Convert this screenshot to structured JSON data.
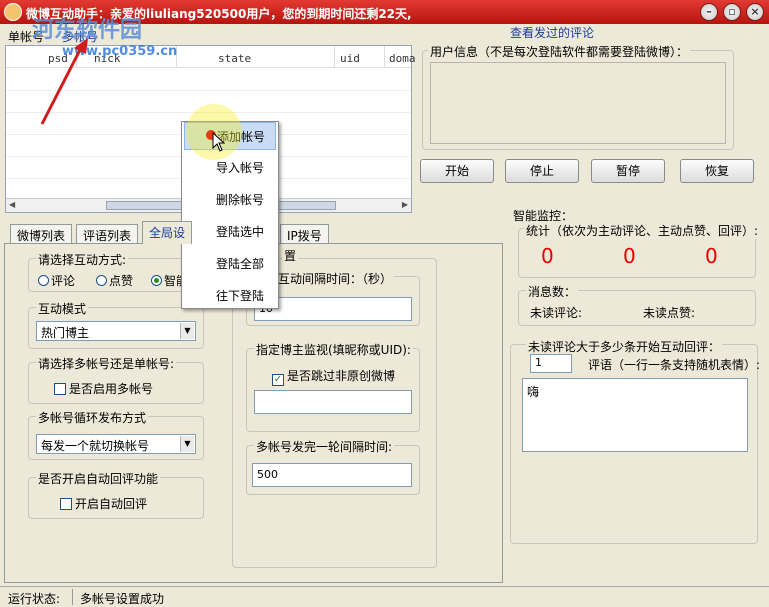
{
  "titlebar": {
    "title": "微博互动助手：亲爱的liuliang520500用户，您的到期时间还剩22天,",
    "min": "–",
    "restore": "▫",
    "close": "×"
  },
  "watermark": {
    "name": "河东软件园",
    "url": "www.pc0359.cn"
  },
  "top_tabs": [
    "单帐号",
    "多帐号"
  ],
  "grid": {
    "columns": [
      "psd",
      "nick",
      "state",
      "uid",
      "doma"
    ]
  },
  "right": {
    "view_comments": "查看发过的评论",
    "user_info_title": "用户信息（不是每次登陆软件都需要登陆微博）：",
    "buttons": {
      "start": "开始",
      "stop": "停止",
      "pause": "暂停",
      "resume": "恢复"
    },
    "monitor_title": "智能监控：",
    "stats_label": "统计（依次为主动评论、主动点赞、回评）:",
    "counts": [
      "0",
      "0",
      "0"
    ],
    "messages_title": "消息数：",
    "unread_comments": "未读评论:",
    "unread_likes": "未读点赞:",
    "threshold_title": "未读评论大于多少条开始互动回评：",
    "threshold_value": "1",
    "reply_label": "评语（一行一条支持随机表情）:",
    "reply_text": "嗨"
  },
  "lower_tabs": [
    "微博列表",
    "评语列表",
    "全局设",
    "IP拨号"
  ],
  "panel": {
    "interact_mode_title": "请选择互动方式:",
    "radio_comment": "评论",
    "radio_like": "点赞",
    "radio_smart": "智能",
    "mode_title": "互动模式",
    "mode_value": "热门博主",
    "multi_title": "请选择多帐号还是单帐号:",
    "multi_checkbox": "是否启用多帐号",
    "cycle_title": "多帐号循环发布方式",
    "cycle_value": "每发一个就切换帐号",
    "auto_reply_title": "是否开启自动回评功能",
    "auto_reply_checkbox": "开启自动回评",
    "interval_group_suffix": "置",
    "interval_title": "互动间隔时间：（秒）",
    "interval_value": "10",
    "blogger_title": "指定博主监视(填昵称或UID):",
    "skip_checkbox": "是否跳过非原创微博",
    "blogger_value": "",
    "round_title": "多帐号发完一轮间隔时间:",
    "round_value": "500"
  },
  "context_menu": [
    "添加帐号",
    "导入帐号",
    "删除帐号",
    "登陆选中",
    "登陆全部",
    "往下登陆"
  ],
  "status": {
    "label": "运行状态:",
    "message": "多帐号设置成功"
  }
}
